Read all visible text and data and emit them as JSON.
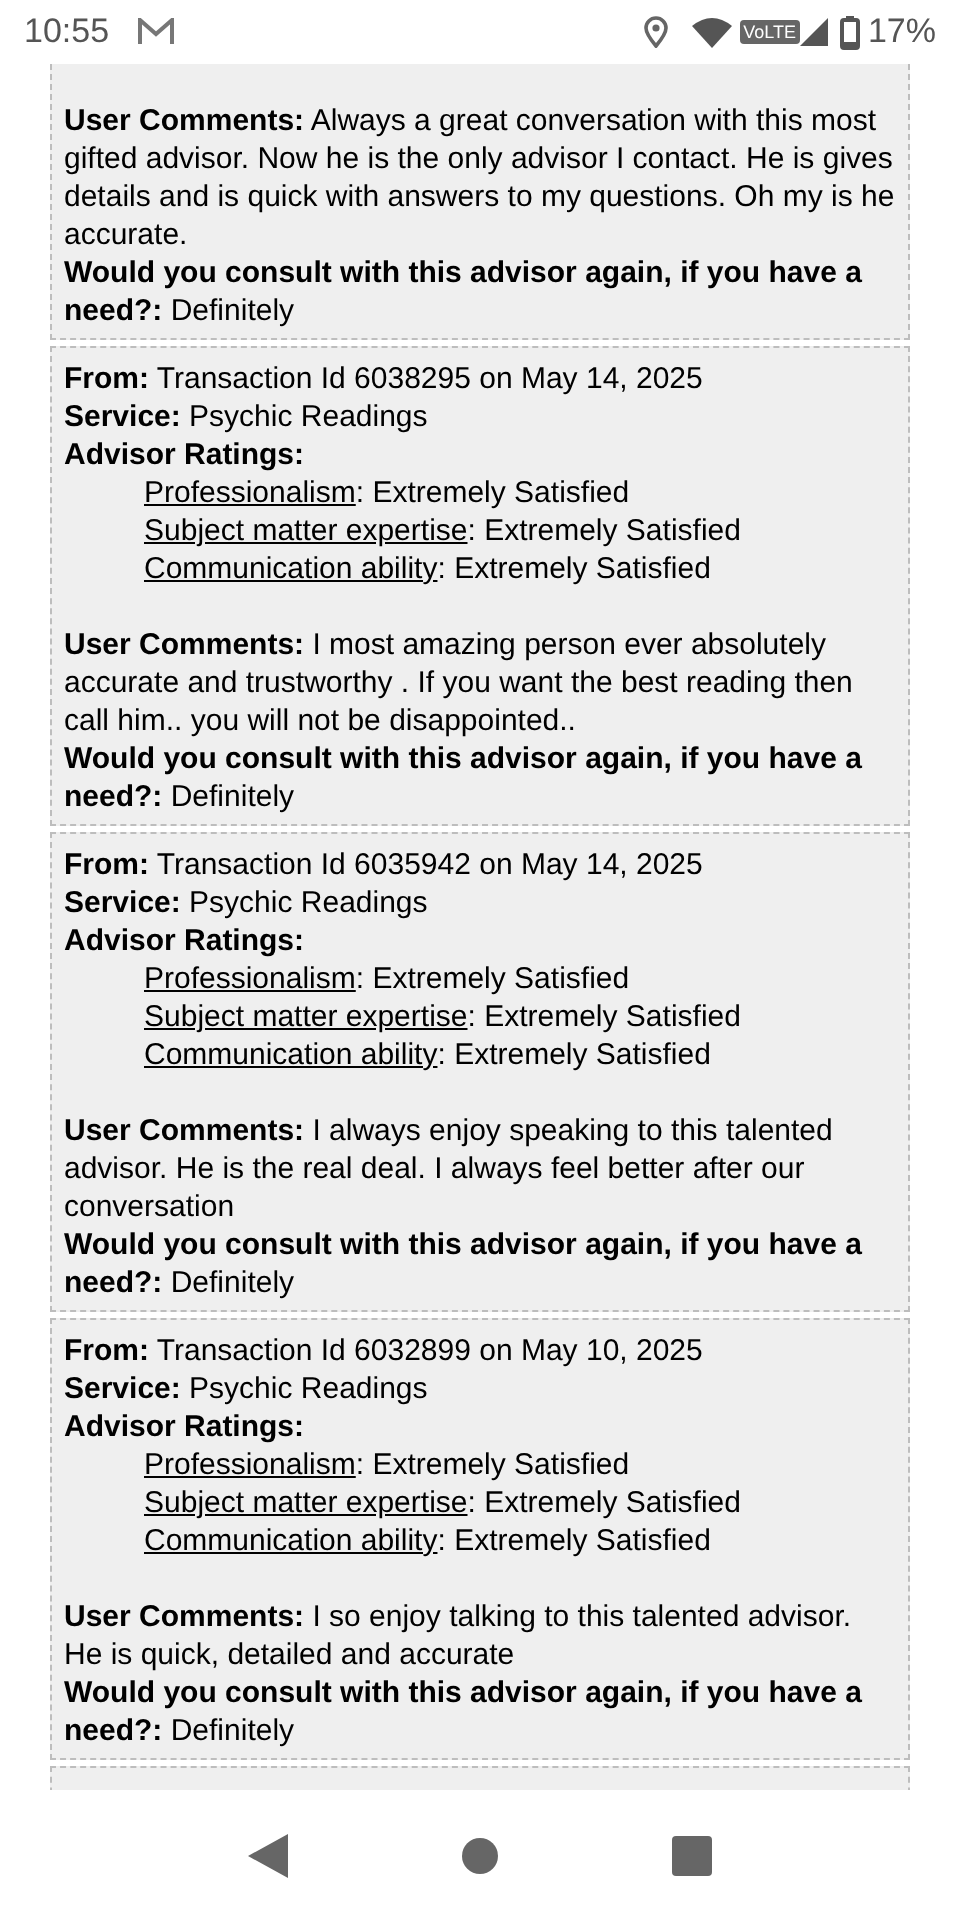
{
  "status_bar": {
    "time": "10:55",
    "volte": "VoLTE",
    "battery": "17%"
  },
  "reviews": [
    {
      "cut_top": true,
      "comments": "**User Comments:** Always a great conversation with this most gifted advisor. Now he is the only advisor I contact. He is gives details and is quick with answers to my questions. Oh my is he accurate.",
      "question": "**Would you consult with this advisor again, if you have a need?:** Definitely"
    },
    {
      "cut_top": false,
      "from": "**From:** Transaction Id 6038295 on May 14, 2025",
      "service": "**Service:** Psychic Readings",
      "ratings_heading": "Advisor Ratings:",
      "ratings": [
        {
          "name": "Professionalism",
          "value": ": Extremely Satisfied"
        },
        {
          "name": "Subject matter expertise",
          "value": ": Extremely Satisfied"
        },
        {
          "name": "Communication ability",
          "value": ": Extremely Satisfied"
        }
      ],
      "comments": "**User Comments:** I most amazing person ever absolutely accurate and trustworthy . If you want the best reading then call him.. you will not be disappointed..",
      "question": "**Would you consult with this advisor again, if you have a need?:** Definitely"
    },
    {
      "cut_top": false,
      "from": "**From:** Transaction Id 6035942 on May 14, 2025",
      "service": "**Service:** Psychic Readings",
      "ratings_heading": "Advisor Ratings:",
      "ratings": [
        {
          "name": "Professionalism",
          "value": ": Extremely Satisfied"
        },
        {
          "name": "Subject matter expertise",
          "value": ": Extremely Satisfied"
        },
        {
          "name": "Communication ability",
          "value": ": Extremely Satisfied"
        }
      ],
      "comments": "**User Comments:** I always enjoy speaking to this talented advisor. He is the real deal. I always feel better after our conversation",
      "question": "**Would you consult with this advisor again, if you have a need?:** Definitely"
    },
    {
      "cut_top": false,
      "from": "**From:** Transaction Id 6032899 on May 10, 2025",
      "service": "**Service:** Psychic Readings",
      "ratings_heading": "Advisor Ratings:",
      "ratings": [
        {
          "name": "Professionalism",
          "value": ": Extremely Satisfied"
        },
        {
          "name": "Subject matter expertise",
          "value": ": Extremely Satisfied"
        },
        {
          "name": "Communication ability",
          "value": ": Extremely Satisfied"
        }
      ],
      "comments": "**User Comments:** I so enjoy talking to this talented advisor. He is quick, detailed and accurate",
      "question": "**Would you consult with this advisor again, if you have a need?:** Definitely"
    }
  ]
}
